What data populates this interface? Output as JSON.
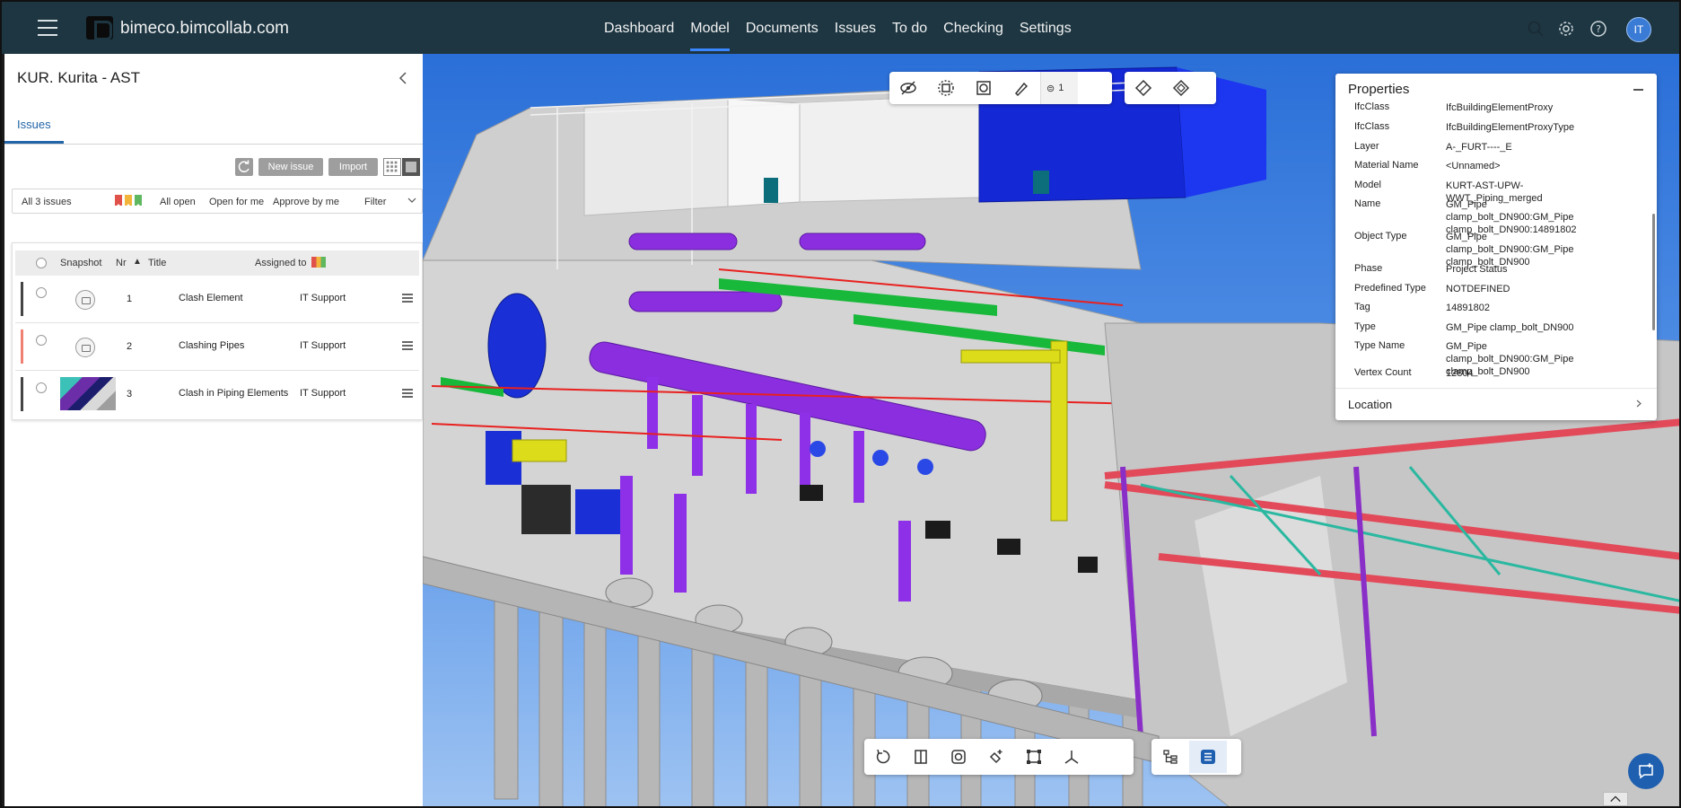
{
  "header": {
    "site_name": "bimeco.bimcollab.com",
    "nav": [
      {
        "label": "Dashboard",
        "active": false
      },
      {
        "label": "Model",
        "active": true
      },
      {
        "label": "Documents",
        "active": false
      },
      {
        "label": "Issues",
        "active": false
      },
      {
        "label": "To do",
        "active": false
      },
      {
        "label": "Checking",
        "active": false
      },
      {
        "label": "Settings",
        "active": false
      }
    ],
    "avatar_initials": "IT",
    "icons": [
      "menu-icon",
      "search-icon",
      "gear-icon",
      "help-icon"
    ]
  },
  "left_panel": {
    "project_title": "KUR. Kurita - AST",
    "tab_label": "Issues",
    "new_issue_label": "New issue",
    "import_label": "Import",
    "filter_bar": {
      "all_issues": "All 3 issues",
      "flags": [
        "#e0514a",
        "#f2b43a",
        "#5fb85f"
      ],
      "all_open": "All open",
      "open_for_me": "Open for me",
      "approve_by_me": "Approve by me",
      "filter": "Filter"
    },
    "table": {
      "headers": {
        "snapshot": "Snapshot",
        "nr": "Nr",
        "sort": "▲",
        "title": "Title",
        "assigned": "Assigned to"
      },
      "rows": [
        {
          "nr": "1",
          "title": "Clash Element",
          "assigned": "IT Support",
          "status_color": "#444444",
          "snapshot": "placeholder"
        },
        {
          "nr": "2",
          "title": "Clashing Pipes",
          "assigned": "IT Support",
          "status_color": "#f08072",
          "snapshot": "placeholder"
        },
        {
          "nr": "3",
          "title": "Clash in Piping Elements",
          "assigned": "IT Support",
          "status_color": "#444444",
          "snapshot": "image"
        }
      ]
    }
  },
  "viewer": {
    "selection_count": "1",
    "top_tools": [
      "hide-eye-icon",
      "isolate-icon",
      "select-box-icon",
      "paint-icon"
    ],
    "top_tools_2": [
      "section-plane-icon",
      "section-box-icon"
    ],
    "bottom_tools": [
      "reset-view-icon",
      "section-icon",
      "focus-icon",
      "measure-icon",
      "frame-icon",
      "axes-icon"
    ],
    "bottom_tools_2": [
      "tree-icon",
      "properties-icon"
    ]
  },
  "properties": {
    "title": "Properties",
    "rows": [
      {
        "key": "IfcClass",
        "value": "IfcBuildingElementProxy"
      },
      {
        "key": "IfcClass",
        "value": "IfcBuildingElementProxyType"
      },
      {
        "key": "Layer",
        "value": "A-_FURT----_E"
      },
      {
        "key": "Material Name",
        "value": "<Unnamed>"
      },
      {
        "key": "Model",
        "value": "KURT-AST-UPW-WWT_Piping_merged"
      },
      {
        "key": "Name",
        "value": "GM_Pipe clamp_bolt_DN900:GM_Pipe clamp_bolt_DN900:14891802"
      },
      {
        "key": "Object Type",
        "value": "GM_Pipe clamp_bolt_DN900:GM_Pipe clamp_bolt_DN900"
      },
      {
        "key": "Phase",
        "value": "Project Status"
      },
      {
        "key": "Predefined Type",
        "value": "NOTDEFINED"
      },
      {
        "key": "Tag",
        "value": "14891802"
      },
      {
        "key": "Type",
        "value": "GM_Pipe clamp_bolt_DN900"
      },
      {
        "key": "Type Name",
        "value": "GM_Pipe clamp_bolt_DN900:GM_Pipe clamp_bolt_DN900"
      },
      {
        "key": "Vertex Count",
        "value": "12804"
      }
    ],
    "location_label": "Location"
  }
}
